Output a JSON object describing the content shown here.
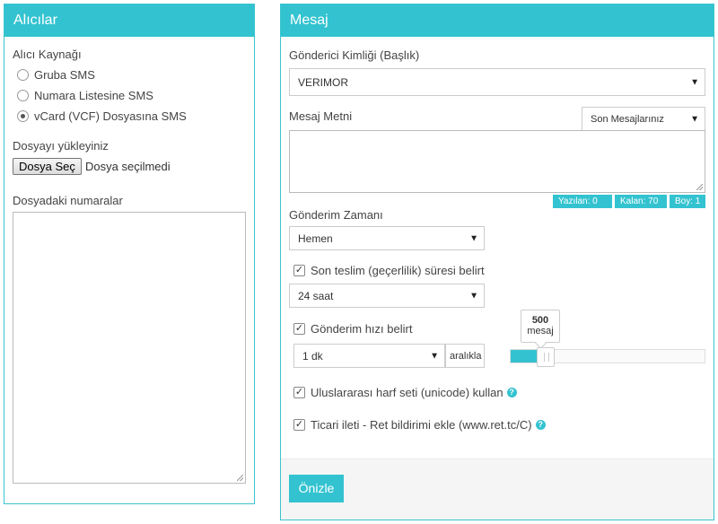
{
  "recipients": {
    "title": "Alıcılar",
    "source_label": "Alıcı Kaynağı",
    "options": [
      {
        "label": "Gruba SMS",
        "selected": false
      },
      {
        "label": "Numara Listesine SMS",
        "selected": false
      },
      {
        "label": "vCard (VCF) Dosyasına SMS",
        "selected": true
      }
    ],
    "upload_label": "Dosyayı yükleyiniz",
    "file_button": "Dosya Seç",
    "file_status": "Dosya seçilmedi",
    "numbers_label": "Dosyadaki numaralar",
    "numbers_value": ""
  },
  "message": {
    "title": "Mesaj",
    "sender_label": "Gönderici Kimliği (Başlık)",
    "sender_value": "VERIMOR",
    "text_label": "Mesaj Metni",
    "recent_select": "Son Mesajlarınız",
    "text_value": "",
    "counters": {
      "written": "Yazılan: 0",
      "remaining": "Kalan: 70",
      "size": "Boy: 1"
    },
    "schedule_label": "Gönderim Zamanı",
    "schedule_value": "Hemen",
    "validity_check": {
      "label": "Son teslim (geçerlilik) süresi belirt",
      "checked": true
    },
    "validity_value": "24 saat",
    "rate_check": {
      "label": "Gönderim hızı belirt",
      "checked": true
    },
    "rate_interval": "1 dk",
    "rate_suffix": "aralıkla",
    "rate_slider": {
      "value": "500",
      "unit": "mesaj",
      "fraction": 0.15
    },
    "unicode_check": {
      "label": "Uluslararası harf seti (unicode) kullan",
      "checked": true
    },
    "commercial_check": {
      "label": "Ticari ileti - Ret bildirimi ekle (www.ret.tc/C)",
      "checked": true
    },
    "preview_button": "Önizle"
  },
  "icons": {
    "check": "✓",
    "arrow": "▼",
    "help": "?"
  },
  "colors": {
    "accent": "#33c3d0"
  }
}
